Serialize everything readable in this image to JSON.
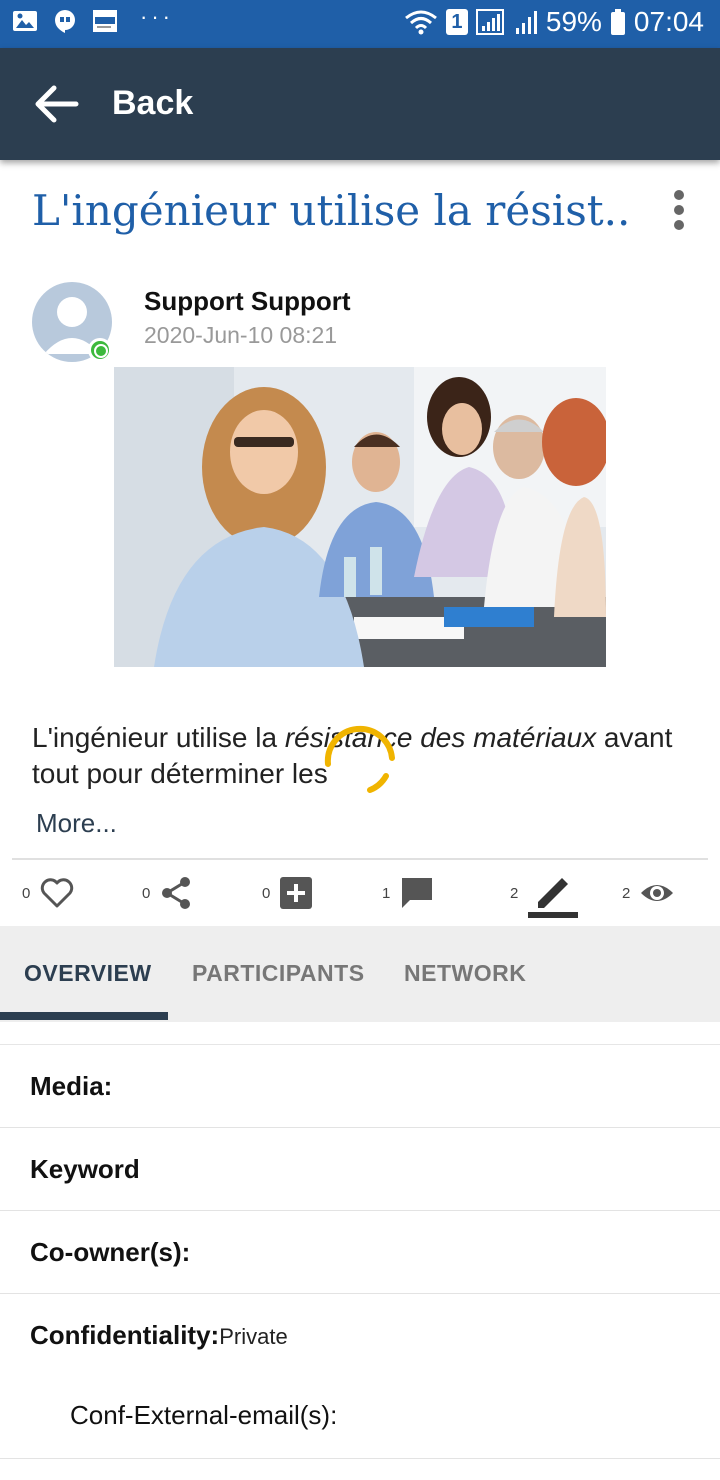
{
  "status_bar": {
    "battery": "59%",
    "time": "07:04",
    "sim_slot": "1",
    "overflow": "···"
  },
  "app_bar": {
    "back_label": "Back"
  },
  "post": {
    "title": "L'ingénieur utilise la résist...",
    "author": "Support Support",
    "date": "2020-Jun-10 08:21",
    "body_part1": "L'ingénieur utilise la ",
    "body_italic1": "résistance des matériaux",
    "body_part2": " avant tout pour déterminer les",
    "more_label": "More..."
  },
  "actions": {
    "likes": "0",
    "shares": "0",
    "adds": "0",
    "comments": "1",
    "edits": "2",
    "views": "2"
  },
  "tabs": [
    {
      "label": "OVERVIEW"
    },
    {
      "label": "PARTICIPANTS"
    },
    {
      "label": "NETWORK"
    }
  ],
  "details": {
    "media_label": "Media:",
    "keyword_label": "Keyword",
    "coowners_label": "Co-owner(s):",
    "confidentiality_label": "Confidentiality:",
    "confidentiality_value": "Private",
    "conf_external_label": "Conf-External-email(s):"
  },
  "colors": {
    "status_bar": "#1f5fa8",
    "app_bar": "#2c3e50",
    "title": "#1f5fa8",
    "spinner": "#f0b400",
    "online": "#3cb93c"
  }
}
